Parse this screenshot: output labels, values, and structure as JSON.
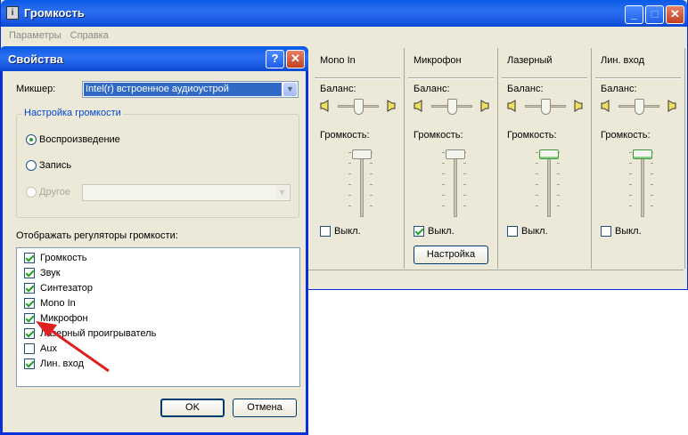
{
  "mixer": {
    "title": "Громкость",
    "icon": "info-icon",
    "menu": [
      "Параметры",
      "Справка"
    ],
    "channels": [
      {
        "name": "Mono In",
        "balance_label": "Баланс:",
        "volume_label": "Громкость:",
        "mute_label": "Выкл.",
        "muted": false,
        "balance": 0.5,
        "volume": 1.0
      },
      {
        "name": "Микрофон",
        "balance_label": "Баланс:",
        "volume_label": "Громкость:",
        "mute_label": "Выкл.",
        "muted": true,
        "balance": 0.5,
        "volume": 1.0,
        "settings_button": "Настройка"
      },
      {
        "name": "Лазерный",
        "balance_label": "Баланс:",
        "volume_label": "Громкость:",
        "mute_label": "Выкл.",
        "muted": false,
        "balance": 0.5,
        "volume": 1.0
      },
      {
        "name": "Лин. вход",
        "balance_label": "Баланс:",
        "volume_label": "Громкость:",
        "mute_label": "Выкл.",
        "muted": false,
        "balance": 0.5,
        "volume": 1.0
      }
    ]
  },
  "dialog": {
    "title": "Свойства",
    "mixer_label": "Микшер:",
    "mixer_value": "Intel(r) встроенное аудиоустрой",
    "group_title": "Настройка громкости",
    "radios": [
      {
        "label": "Воспроизведение",
        "selected": true,
        "disabled": false
      },
      {
        "label": "Запись",
        "selected": false,
        "disabled": false
      },
      {
        "label": "Другое",
        "selected": false,
        "disabled": true
      }
    ],
    "list_label": "Отображать регуляторы громкости:",
    "controls": [
      {
        "label": "Громкость",
        "checked": true
      },
      {
        "label": "Звук",
        "checked": true
      },
      {
        "label": "Синтезатор",
        "checked": true
      },
      {
        "label": "Mono In",
        "checked": true
      },
      {
        "label": "Микрофон",
        "checked": true
      },
      {
        "label": "Лазерный проигрыватель",
        "checked": true
      },
      {
        "label": "Aux",
        "checked": false
      },
      {
        "label": "Лин. вход",
        "checked": true
      }
    ],
    "ok_button": "OK",
    "cancel_button": "Отмена",
    "help_button": "?",
    "close_button": "✕"
  },
  "window_buttons": {
    "minimize": "_",
    "maximize": "□",
    "close": "✕"
  },
  "colors": {
    "titlebar": "#0a5ae6",
    "arrow": "#e02020",
    "check": "#21a121"
  }
}
